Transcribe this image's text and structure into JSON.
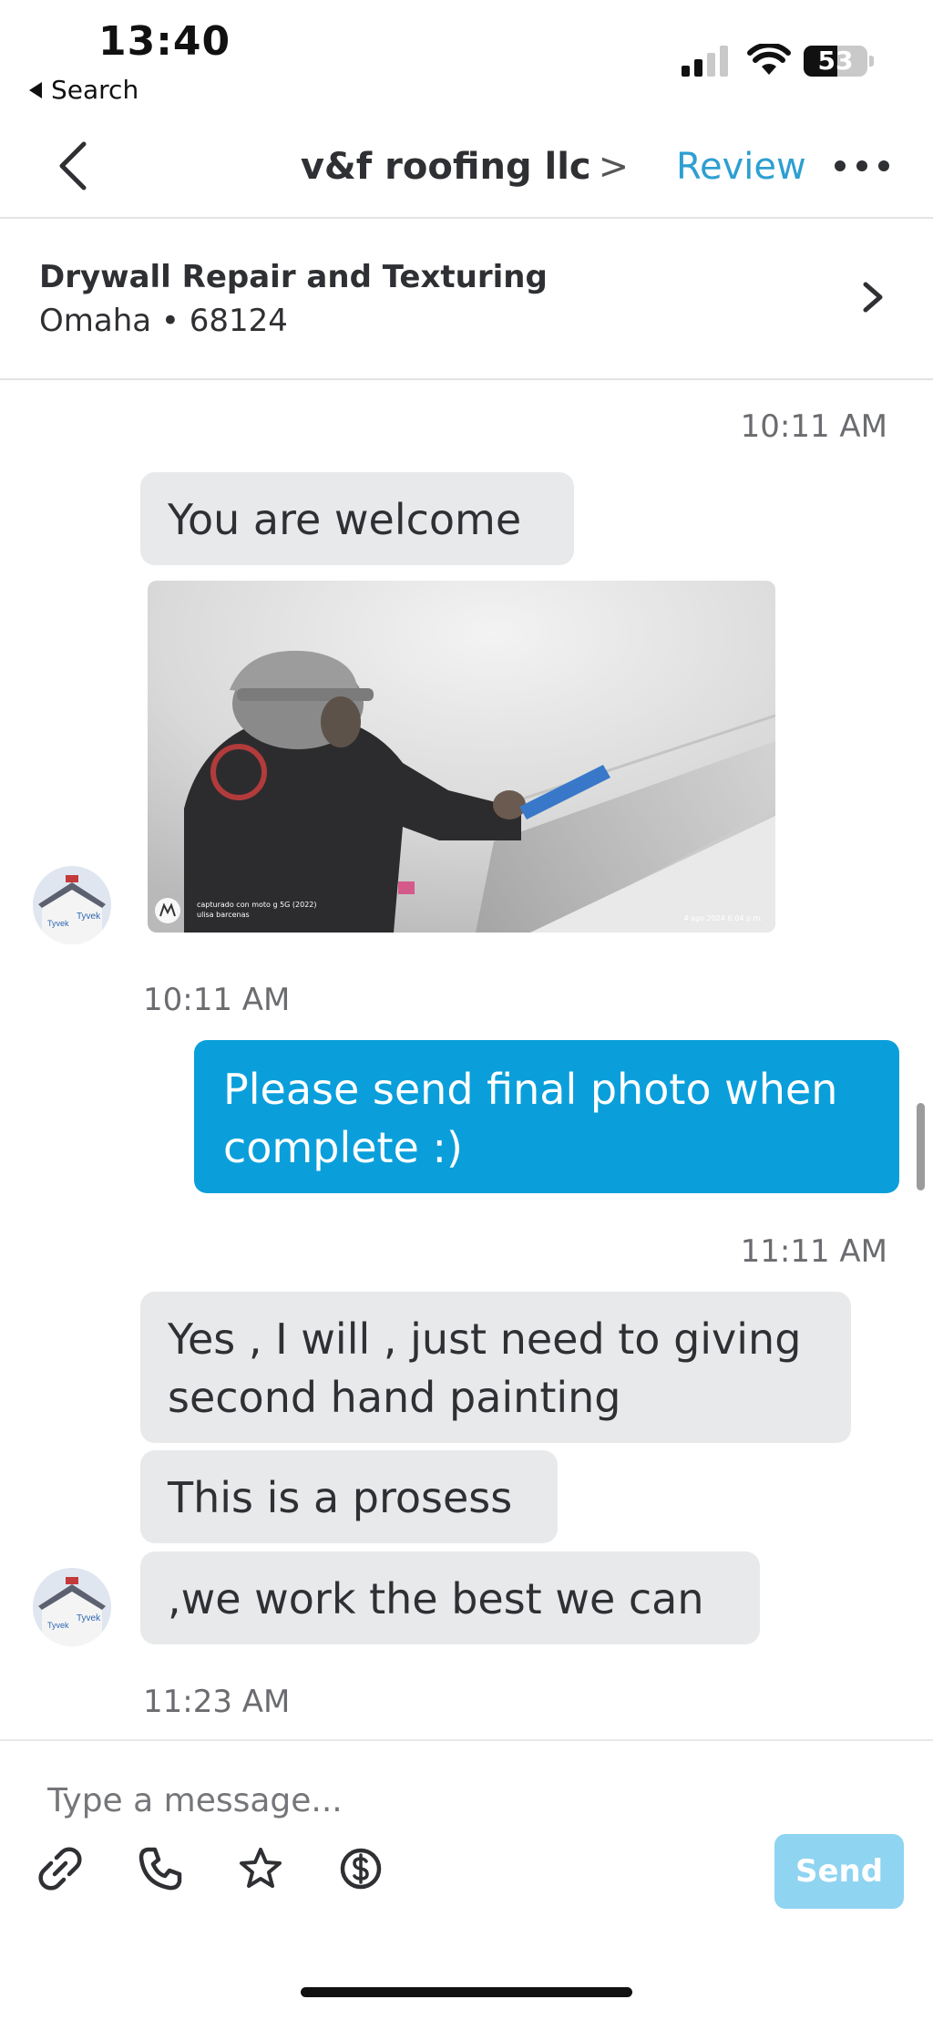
{
  "status_bar": {
    "time": "13:40",
    "back_label": "Search",
    "battery": "53",
    "battery_level": 0.53
  },
  "header": {
    "title": "v&f roofing llc",
    "title_chevron": ">",
    "review_label": "Review",
    "more_icon": "more-dots-icon"
  },
  "job": {
    "title": "Drywall Repair and Texturing",
    "location": "Omaha • 68124"
  },
  "messages": [
    {
      "timestamp": "10:11 AM"
    },
    {
      "text": "You are welcome"
    },
    {
      "photo": {
        "watermark_line1": "capturado con moto g 5G (2022)",
        "watermark_line2": "ulisa barcenas",
        "watermark_right": "4 ago 2024 6:04 p.m."
      }
    },
    {
      "timestamp": "10:11 AM"
    },
    {
      "text": "Please send final photo when complete :)"
    },
    {
      "timestamp": "11:11 AM"
    },
    {
      "text": "Yes , I will , just need to giving second hand painting"
    },
    {
      "text": "This is a prosess"
    },
    {
      "text": ",we work the best we can"
    },
    {
      "timestamp": "11:23 AM"
    }
  ],
  "composer": {
    "placeholder": "Type a message...",
    "send_label": "Send",
    "tools": [
      "paperclip-icon",
      "phone-icon",
      "star-icon",
      "dollar-icon"
    ]
  },
  "colors": {
    "accent": "#2e9fd1",
    "outgoing_bubble": "#0a9fdb",
    "incoming_bubble": "#e8e9eb",
    "send_disabled": "#8fd4f1"
  }
}
